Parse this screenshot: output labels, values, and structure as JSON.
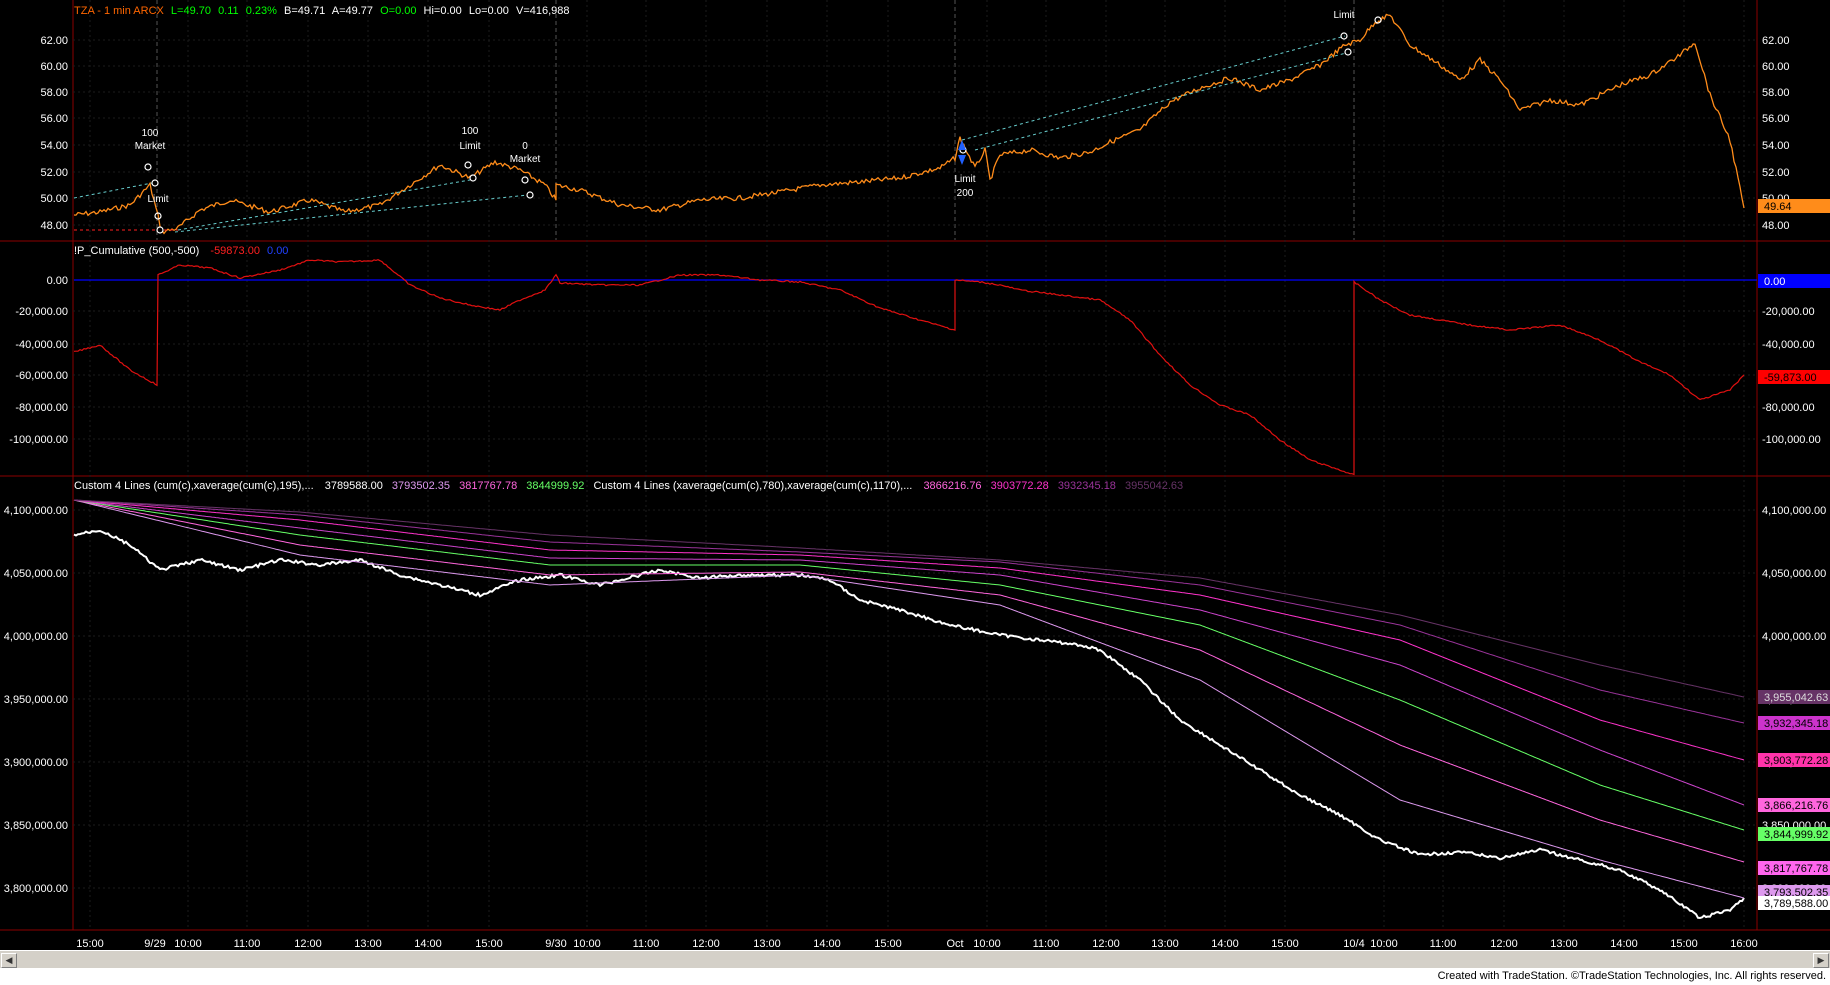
{
  "panels": {
    "price": {
      "symbol_line": "TZA - 1 min ARCX",
      "last": "L=49.70",
      "change": "0.11",
      "change_pct": "0.23%",
      "bid": "B=49.71",
      "ask": "A=49.77",
      "open": "O=0.00",
      "high": "Hi=0.00",
      "low": "Lo=0.00",
      "volume": "V=416,988",
      "yticks": [
        "62.00",
        "60.00",
        "58.00",
        "56.00",
        "54.00",
        "52.00",
        "50.00",
        "48.00"
      ],
      "last_tag": "49.64",
      "annotations": [
        {
          "text": "100"
        },
        {
          "text": "Market"
        },
        {
          "text": "Limit"
        },
        {
          "text": "100"
        },
        {
          "text": "Limit"
        },
        {
          "text": "0"
        },
        {
          "text": "Market"
        },
        {
          "text": "Limit"
        },
        {
          "text": "200"
        },
        {
          "text": "Limit"
        }
      ]
    },
    "indicator": {
      "title": "!P_Cumulative (500,-500)",
      "value1": "-59873.00",
      "value2": "0.00",
      "yticks": [
        "0.00",
        "-20,000.00",
        "-40,000.00",
        "-60,000.00",
        "-80,000.00",
        "-100,000.00"
      ],
      "tag_blue": "0.00",
      "tag_red": "-59,873.00"
    },
    "lines": {
      "title1": "Custom 4 Lines (cum(c),xaverage(cum(c),195),...",
      "v1": "3789588.00",
      "v2": "3793502.35",
      "v3": "3817767.78",
      "v4": "3844999.92",
      "title2": "Custom 4 Lines (xaverage(cum(c),780),xaverage(cum(c),1170),...",
      "v5": "3866216.76",
      "v6": "3903772.28",
      "v7": "3932345.18",
      "v8": "3955042.63",
      "yticks": [
        "4,100,000.00",
        "4,050,000.00",
        "4,000,000.00",
        "3,950,000.00",
        "3,900,000.00",
        "3,850,000.00",
        "3,800,000.00"
      ],
      "tags": [
        "3,955,042.63",
        "3,932,345.18",
        "3,903,772.28",
        "3,866,216.76",
        "3,844,999.92",
        "3,817,767.78",
        "3,793,502.35",
        "3,789,588.00"
      ]
    }
  },
  "xaxis": [
    "15:00",
    "9/29",
    "10:00",
    "11:00",
    "12:00",
    "13:00",
    "14:00",
    "15:00",
    "9/30",
    "10:00",
    "11:00",
    "12:00",
    "13:00",
    "14:00",
    "15:00",
    "Oct",
    "10:00",
    "11:00",
    "12:00",
    "13:00",
    "14:00",
    "15:00",
    "10/4",
    "10:00",
    "11:00",
    "12:00",
    "13:00",
    "14:00",
    "15:00",
    "16:00"
  ],
  "footer": "Created with TradeStation. ©TradeStation Technologies, Inc. All rights reserved.",
  "colors": {
    "price": "#ff8c1a",
    "cumulative": "#e01010",
    "zero": "#0000ff",
    "white": "#ffffff",
    "green": "#66ff66",
    "magenta": "#ff33cc",
    "pink": "#ff66dd",
    "violet": "#cc44cc",
    "purple": "#993399",
    "dark_purple": "#663366",
    "lilac": "#dd99ee",
    "teal": "#66cccc",
    "divider": "#8b0000"
  }
}
